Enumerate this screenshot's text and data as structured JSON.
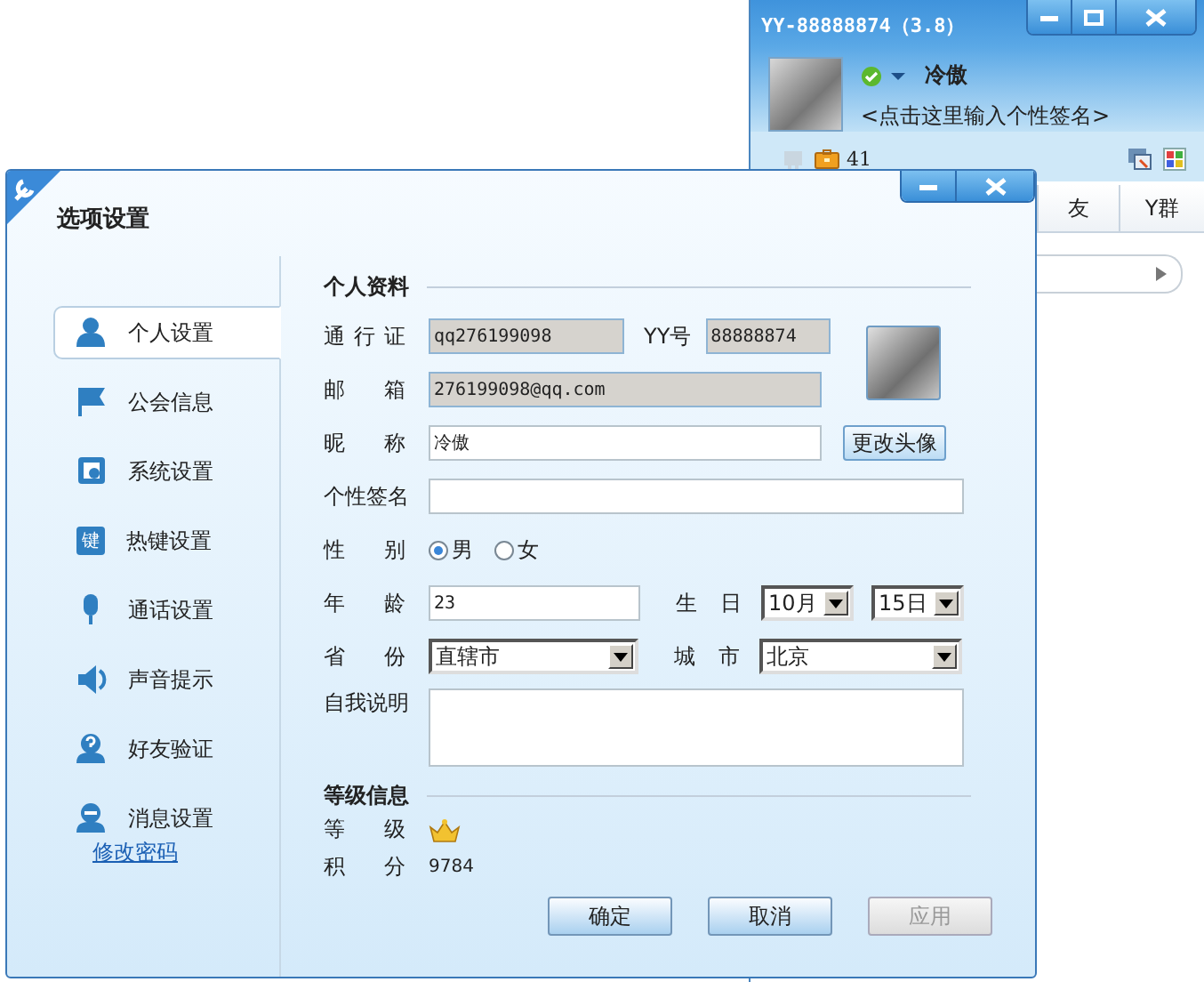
{
  "main_window": {
    "title": "YY-88888874（3.8）",
    "nickname": "冷傲",
    "signature_prompt": "<点击这里输入个性签名>",
    "coins": "41",
    "tabs": [
      {
        "label": "友",
        "selected": false
      },
      {
        "label": "Y群",
        "selected": false
      }
    ]
  },
  "dialog": {
    "title": "选项设置",
    "sidebar": {
      "items": [
        {
          "label": "个人设置",
          "kind": "person",
          "selected": true
        },
        {
          "label": "公会信息",
          "kind": "flag",
          "selected": false
        },
        {
          "label": "系统设置",
          "kind": "system",
          "selected": false
        },
        {
          "label": "热键设置",
          "kind": "key",
          "icon_text": "键",
          "selected": false
        },
        {
          "label": "通话设置",
          "kind": "mic",
          "selected": false
        },
        {
          "label": "声音提示",
          "kind": "speaker",
          "selected": false
        },
        {
          "label": "好友验证",
          "kind": "question",
          "selected": false
        },
        {
          "label": "消息设置",
          "kind": "minus",
          "selected": false
        }
      ],
      "link": "修改密码"
    },
    "profile": {
      "heading": "个人资料",
      "passport": {
        "label": "通 行 证",
        "value": "qq276199098",
        "readonly": true
      },
      "yy_number": {
        "label": "YY号",
        "value": "88888874",
        "readonly": true
      },
      "email": {
        "label": "邮 箱",
        "value": "276199098@qq.com",
        "readonly": true
      },
      "nickname": {
        "label": "昵 称",
        "value": "冷傲",
        "readonly": false
      },
      "change_avatar_button": "更改头像",
      "signature": {
        "label": "个性签名",
        "readonly": false
      },
      "gender": {
        "label": "性 别",
        "options": [
          {
            "label": "男",
            "selected": true
          },
          {
            "label": "女",
            "selected": false
          }
        ]
      },
      "age": {
        "label": "年 龄",
        "value": "23",
        "readonly": false
      },
      "birthday": {
        "label": "生 日",
        "month": "10月",
        "day": "15日"
      },
      "province": {
        "label": "省 份",
        "value": "直辖市"
      },
      "city": {
        "label": "城 市",
        "value": "北京"
      },
      "about": {
        "label": "自我说明"
      }
    },
    "level_info": {
      "heading": "等级信息",
      "level_label": "等 级",
      "points_label": "积 分",
      "points": "9784"
    },
    "buttons": [
      {
        "label": "确定",
        "disabled": false
      },
      {
        "label": "取消",
        "disabled": false
      },
      {
        "label": "应用",
        "disabled": true
      }
    ]
  }
}
